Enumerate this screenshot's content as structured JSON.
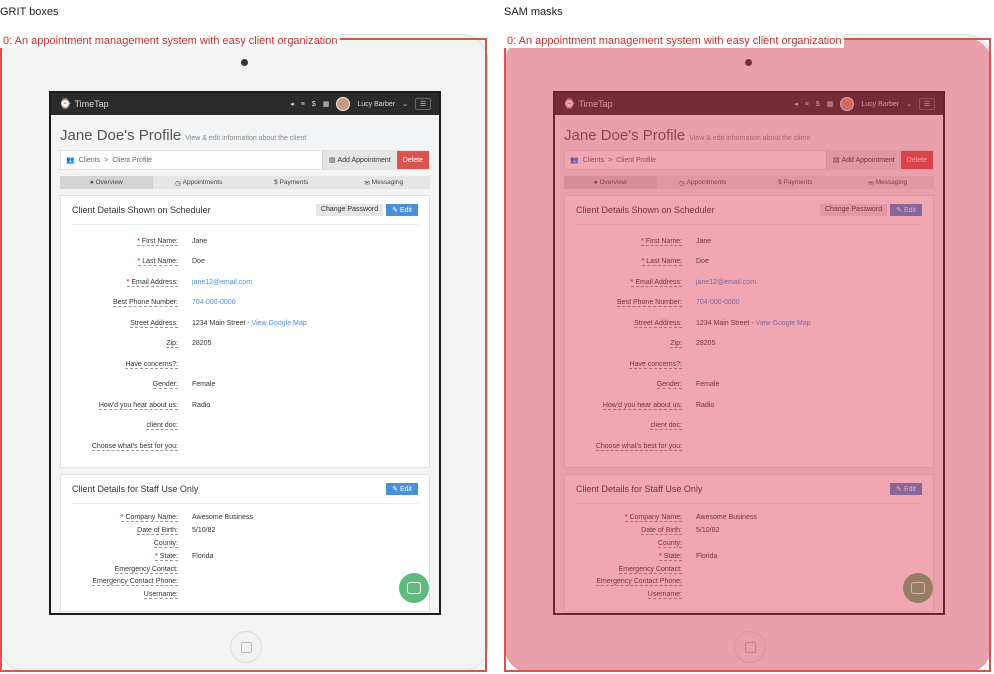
{
  "panels": {
    "left_title": "GRIT boxes",
    "right_title": "SAM masks",
    "box_label": "0: An appointment management system with easy client organization",
    "mask_label": "0: An appointment management system with easy client organization"
  },
  "app": {
    "logo": "TimeTap",
    "user": "Lucy Barber",
    "page_title": "Jane Doe's Profile",
    "page_subtitle": "View & edit information about the client",
    "breadcrumb": {
      "root": "Clients",
      "sep": ">",
      "current": "Client Profile"
    },
    "buttons": {
      "add_appointment": "Add Appointment",
      "delete": "Delete",
      "change_password": "Change Password",
      "edit": "Edit"
    },
    "tabs": [
      {
        "label": "Overview",
        "icon": "user-icon"
      },
      {
        "label": "Appointments",
        "icon": "clock-icon"
      },
      {
        "label": "Payments",
        "icon": "dollar-icon"
      },
      {
        "label": "Messaging",
        "icon": "envelope-icon"
      }
    ],
    "section1": {
      "title": "Client Details Shown on Scheduler",
      "fields": [
        {
          "label": "First Name:",
          "required": true,
          "value": "Jane"
        },
        {
          "label": "Last Name:",
          "required": true,
          "value": "Doe"
        },
        {
          "label": "Email Address:",
          "required": true,
          "value": "jane12@email.com",
          "link": true
        },
        {
          "label": "Best Phone Number:",
          "required": false,
          "value": "704-000-0000",
          "link": true
        },
        {
          "label": "Street Address:",
          "required": false,
          "value": "1234 Main Street",
          "extra": "View Google Map"
        },
        {
          "label": "Zip:",
          "required": false,
          "value": "28205"
        },
        {
          "label": "Have concerns?:",
          "required": false,
          "value": ""
        },
        {
          "label": "Gender:",
          "required": false,
          "value": "Female"
        },
        {
          "label": "How'd you hear about us:",
          "required": false,
          "value": "Radio"
        },
        {
          "label": "client doc:",
          "required": false,
          "value": ""
        },
        {
          "label": "Choose what's best for you:",
          "required": false,
          "value": ""
        }
      ]
    },
    "section2": {
      "title": "Client Details for Staff Use Only",
      "fields": [
        {
          "label": "Company Name:",
          "required": true,
          "value": "Awesome Business"
        },
        {
          "label": "Date of Birth:",
          "required": false,
          "value": "5/10/82"
        },
        {
          "label": "County:",
          "required": false,
          "value": ""
        },
        {
          "label": "State:",
          "required": true,
          "value": "Florida"
        },
        {
          "label": "Emergency Contact:",
          "required": false,
          "value": ""
        },
        {
          "label": "Emergency Contact Phone:",
          "required": false,
          "value": ""
        },
        {
          "label": "Username:",
          "required": false,
          "value": ""
        }
      ]
    }
  }
}
